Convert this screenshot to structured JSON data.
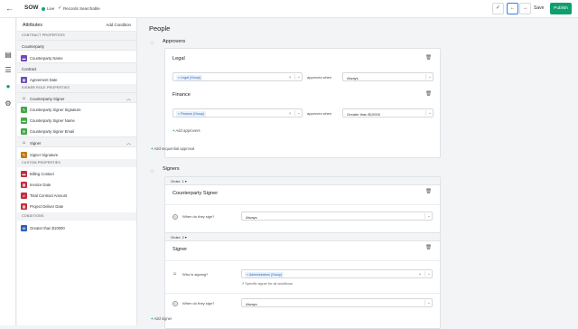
{
  "topbar": {
    "title": "SOW",
    "status": "Live",
    "searchable": "Records Searchable",
    "save_label": "Save",
    "publish_label": "Publish"
  },
  "panel": {
    "title": "Attributes",
    "add_condition": "Add Condition",
    "sections": {
      "contract_properties": "CONTRACT PROPERTIES",
      "signer_role_properties": "SIGNER ROLE PROPERTIES",
      "custom_properties": "CUSTOM PROPERTIES",
      "conditions": "CONDITIONS"
    },
    "counterparty_group": "Counterparty",
    "counterparty_name": "Counterparty Name",
    "contract_group": "Contract",
    "agreement_date": "Agreement Date",
    "counterparty_signer_group": "Counterparty Signer",
    "cp_signer_items": [
      "Counterparty Signer Signature",
      "Counterparty Signer Name",
      "Counterparty Signer Email"
    ],
    "signer_group": "Signer",
    "signer_signature": "Signer Signature",
    "custom_items": [
      "Billing Contact",
      "Invoice Date",
      "Total Contract Amount",
      "Project Deliver Date"
    ],
    "condition_item": "Greater than $10000"
  },
  "main": {
    "page_title": "People",
    "approvers_title": "Approvers",
    "legal": {
      "title": "Legal",
      "tag": "Legal (Group)",
      "approves_when": "approves when",
      "condition": "Always"
    },
    "finance": {
      "title": "Finance",
      "tag": "Finance (Group)",
      "approves_when": "approves when",
      "condition": "Greater than $10000"
    },
    "add_approver": "Add approvers",
    "add_sequential": "Add sequential approval",
    "signers_title": "Signers",
    "order1": "Order: 1",
    "counterparty_signer": "Counterparty Signer",
    "when_sign_q": "When do they sign?",
    "always": "Always",
    "order2": "Order: 2",
    "signer": "Signer",
    "who_signing_q": "Who is signing?",
    "admin_tag": "Administrators (Group)",
    "specific_signer": "Specific signer for all workflows",
    "add_signer": "Add signer"
  },
  "colors": {
    "brand": "#0f9f6e",
    "chip_purple": "#6b4bb8",
    "chip_green": "#41a94a",
    "chip_red": "#c42d3e",
    "chip_orange": "#c27a16",
    "chip_blue": "#2f5fb5"
  }
}
